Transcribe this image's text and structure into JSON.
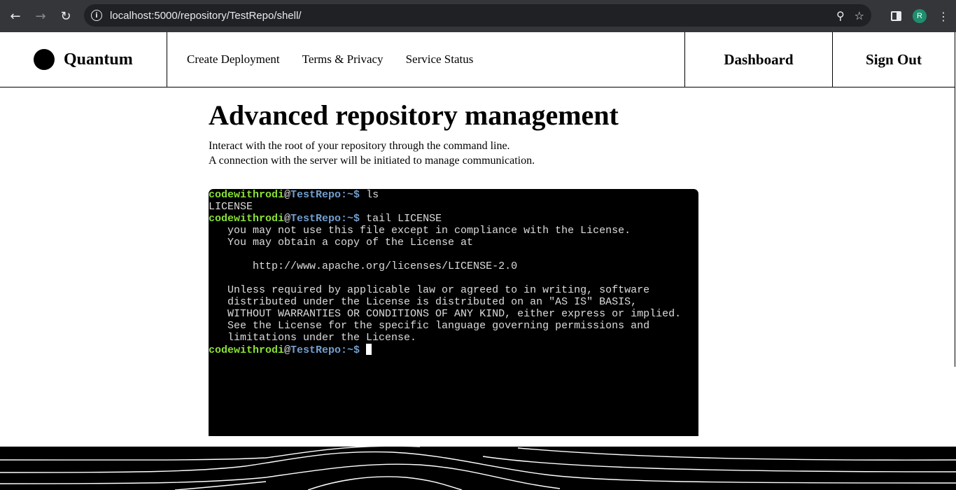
{
  "browser": {
    "back_icon": "arrow-left-icon",
    "forward_icon": "arrow-right-icon",
    "reload_icon": "reload-icon",
    "url": "localhost:5000/repository/TestRepo/shell/",
    "avatar_letter": "R",
    "avatar_color": "#1e8e6e"
  },
  "header": {
    "brand": "Quantum",
    "nav": [
      "Create Deployment",
      "Terms & Privacy",
      "Service Status"
    ],
    "dashboard": "Dashboard",
    "sign_out": "Sign Out"
  },
  "main": {
    "title": "Advanced repository management",
    "desc_line1": "Interact with the root of your repository through the command line.",
    "desc_line2": "A connection with the server will be initiated to manage communication."
  },
  "terminal": {
    "prompt_user": "codewithrodi",
    "prompt_at": "@",
    "prompt_host": "TestRepo:~$",
    "cmd1": " ls",
    "out1": "LICENSE",
    "cmd2": " tail LICENSE",
    "output": [
      "   you may not use this file except in compliance with the License.",
      "   You may obtain a copy of the License at",
      "",
      "       http://www.apache.org/licenses/LICENSE-2.0",
      "",
      "   Unless required by applicable law or agreed to in writing, software",
      "   distributed under the License is distributed on an \"AS IS\" BASIS,",
      "   WITHOUT WARRANTIES OR CONDITIONS OF ANY KIND, either express or implied.",
      "   See the License for the specific language governing permissions and",
      "   limitations under the License."
    ],
    "colors": {
      "user": "#8ae234",
      "host": "#729fcf",
      "text": "#dddddd",
      "background": "#000000"
    }
  }
}
